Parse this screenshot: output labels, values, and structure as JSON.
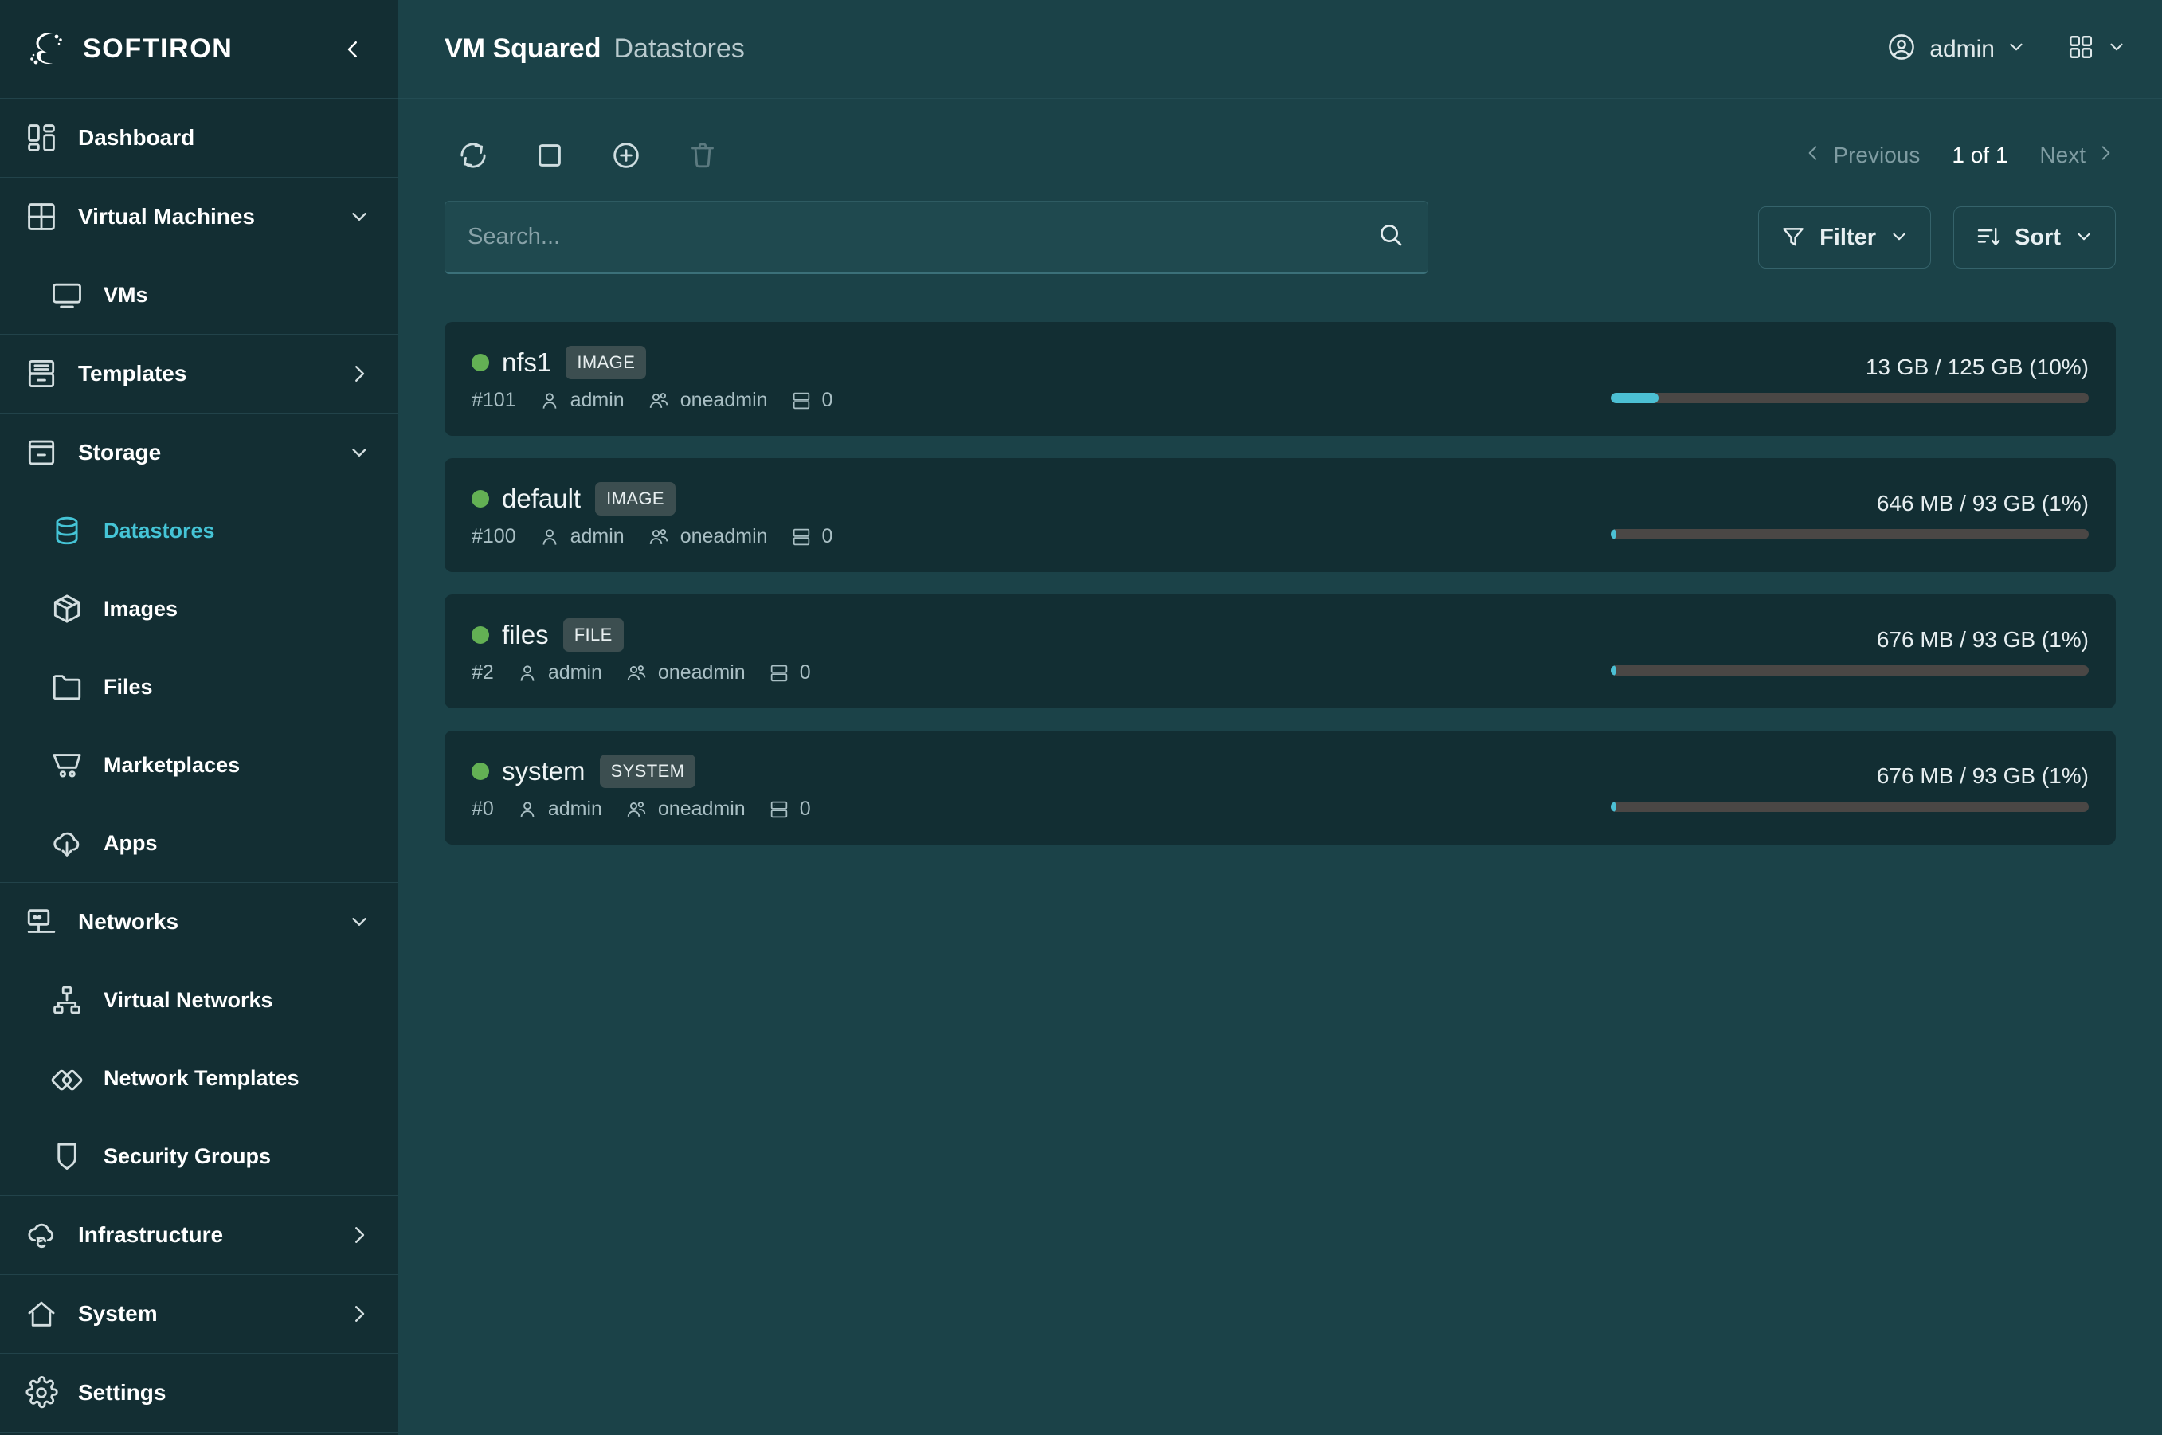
{
  "brand": {
    "name": "SOFTIRON",
    "logo_icon": "softiron-logo-icon",
    "collapse_icon": "chevron-left-icon"
  },
  "sidebar": {
    "groups": [
      {
        "items": [
          {
            "label": "Dashboard",
            "icon": "dashboard-icon",
            "level": "top",
            "chevron": "",
            "active": false
          }
        ]
      },
      {
        "items": [
          {
            "label": "Virtual Machines",
            "icon": "grid-squares-icon",
            "level": "top",
            "chevron": "down",
            "active": false
          },
          {
            "label": "VMs",
            "icon": "monitor-icon",
            "level": "sub",
            "chevron": "",
            "active": false
          }
        ]
      },
      {
        "items": [
          {
            "label": "Templates",
            "icon": "drawer-icon",
            "level": "top",
            "chevron": "right",
            "active": false
          }
        ]
      },
      {
        "items": [
          {
            "label": "Storage",
            "icon": "storage-box-icon",
            "level": "top",
            "chevron": "down",
            "active": false
          },
          {
            "label": "Datastores",
            "icon": "database-icon",
            "level": "sub",
            "chevron": "",
            "active": true
          },
          {
            "label": "Images",
            "icon": "package-box-icon",
            "level": "sub",
            "chevron": "",
            "active": false
          },
          {
            "label": "Files",
            "icon": "folder-icon",
            "level": "sub",
            "chevron": "",
            "active": false
          },
          {
            "label": "Marketplaces",
            "icon": "shopping-cart-icon",
            "level": "sub",
            "chevron": "",
            "active": false
          },
          {
            "label": "Apps",
            "icon": "cloud-download-icon",
            "level": "sub",
            "chevron": "",
            "active": false
          }
        ]
      },
      {
        "items": [
          {
            "label": "Networks",
            "icon": "network-monitor-icon",
            "level": "top",
            "chevron": "down",
            "active": false
          },
          {
            "label": "Virtual Networks",
            "icon": "sitemap-icon",
            "level": "sub",
            "chevron": "",
            "active": false
          },
          {
            "label": "Network Templates",
            "icon": "diamonds-icon",
            "level": "sub",
            "chevron": "",
            "active": false
          },
          {
            "label": "Security Groups",
            "icon": "shield-icon",
            "level": "sub",
            "chevron": "",
            "active": false
          }
        ]
      },
      {
        "items": [
          {
            "label": "Infrastructure",
            "icon": "cloud-sync-icon",
            "level": "top",
            "chevron": "right",
            "active": false
          }
        ]
      },
      {
        "items": [
          {
            "label": "System",
            "icon": "home-icon",
            "level": "top",
            "chevron": "right",
            "active": false
          }
        ]
      },
      {
        "items": [
          {
            "label": "Settings",
            "icon": "gear-icon",
            "level": "top",
            "chevron": "",
            "active": false
          }
        ]
      }
    ]
  },
  "topbar": {
    "title": "VM Squared",
    "subtitle": "Datastores",
    "user": "admin",
    "user_icon": "user-circle-icon",
    "user_chevron_icon": "chevron-down-icon",
    "apps_icon": "apps-grid-icon",
    "apps_chevron_icon": "chevron-down-icon"
  },
  "toolbar": {
    "buttons": [
      {
        "name": "refresh-button",
        "icon": "refresh-icon"
      },
      {
        "name": "select-all-button",
        "icon": "square-icon"
      },
      {
        "name": "create-button",
        "icon": "plus-circle-icon"
      },
      {
        "name": "delete-button",
        "icon": "trash-icon"
      }
    ],
    "pagination": {
      "previous_label": "Previous",
      "count_label": "1 of 1",
      "next_label": "Next",
      "prev_icon": "chevron-left-icon",
      "next_icon": "chevron-right-icon"
    }
  },
  "search": {
    "placeholder": "Search...",
    "value": "",
    "icon": "search-icon"
  },
  "controls": {
    "filter_label": "Filter",
    "filter_icon": "funnel-icon",
    "sort_label": "Sort",
    "sort_icon": "sort-descending-icon",
    "chevron_icon": "chevron-down-icon"
  },
  "colors": {
    "accent": "#45c4d6",
    "progress_fill": "#4cc0d4",
    "progress_track": "#4a4745",
    "status_ok": "#63b054",
    "sidebar_bg": "#132e33",
    "main_bg": "#1b4248",
    "card_bg": "#122e33",
    "badge_bg": "#3c4e50"
  },
  "datastores": [
    {
      "name": "nfs1",
      "type": "IMAGE",
      "status": "ok",
      "id": "#101",
      "owner": "admin",
      "group": "oneadmin",
      "images": "0",
      "capacity_text": "13 GB / 125 GB (10%)",
      "used": "13 GB",
      "total": "125 GB",
      "percent": 10
    },
    {
      "name": "default",
      "type": "IMAGE",
      "status": "ok",
      "id": "#100",
      "owner": "admin",
      "group": "oneadmin",
      "images": "0",
      "capacity_text": "646 MB / 93 GB (1%)",
      "used": "646 MB",
      "total": "93 GB",
      "percent": 1
    },
    {
      "name": "files",
      "type": "FILE",
      "status": "ok",
      "id": "#2",
      "owner": "admin",
      "group": "oneadmin",
      "images": "0",
      "capacity_text": "676 MB / 93 GB (1%)",
      "used": "676 MB",
      "total": "93 GB",
      "percent": 1
    },
    {
      "name": "system",
      "type": "SYSTEM",
      "status": "ok",
      "id": "#0",
      "owner": "admin",
      "group": "oneadmin",
      "images": "0",
      "capacity_text": "676 MB / 93 GB (1%)",
      "used": "676 MB",
      "total": "93 GB",
      "percent": 1
    }
  ]
}
